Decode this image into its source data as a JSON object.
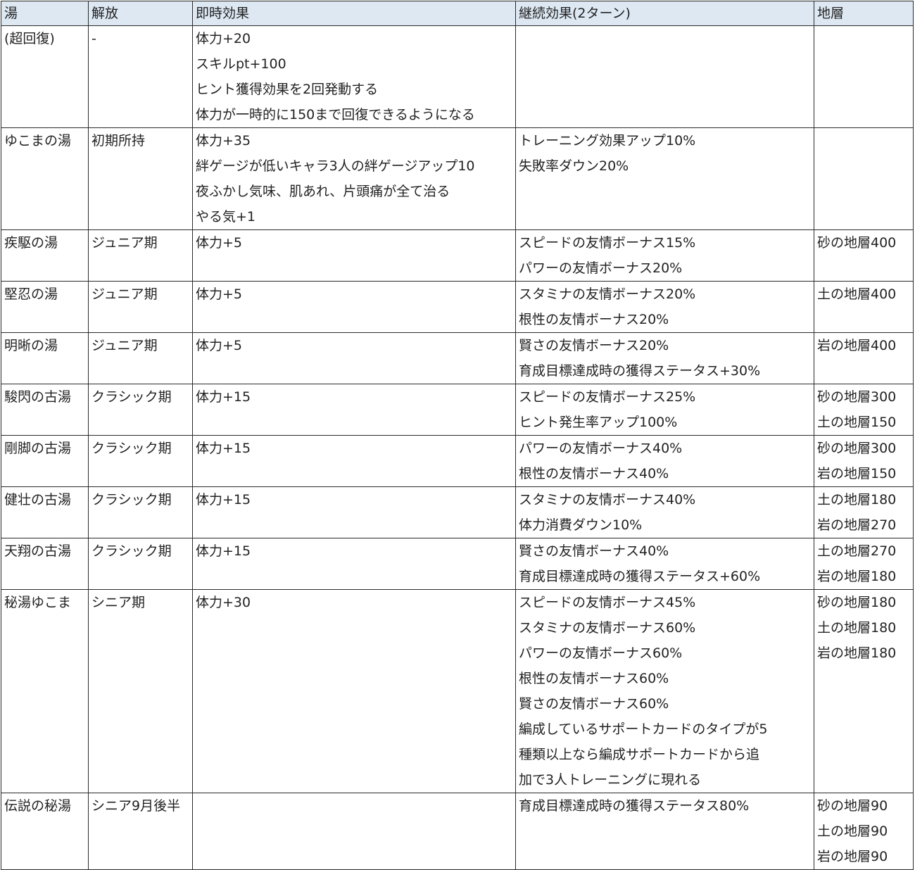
{
  "headers": [
    "湯",
    "解放",
    "即時効果",
    "継続効果(2ターン)",
    "地層"
  ],
  "rows": [
    {
      "name": "(超回復)",
      "unlock": "-",
      "immediate": [
        "体力+20",
        "スキルpt+100",
        "ヒント獲得効果を2回発動する",
        "体力が一時的に150まで回復できるようになる"
      ],
      "continuous": [],
      "strata": []
    },
    {
      "name": "ゆこまの湯",
      "unlock": "初期所持",
      "immediate": [
        "体力+35",
        "絆ゲージが低いキャラ3人の絆ゲージアップ10",
        "夜ふかし気味、肌あれ、片頭痛が全て治る",
        "やる気+1"
      ],
      "continuous": [
        "トレーニング効果アップ10%",
        "失敗率ダウン20%"
      ],
      "strata": []
    },
    {
      "name": "疾駆の湯",
      "unlock": "ジュニア期",
      "immediate": [
        "体力+5"
      ],
      "continuous": [
        "スピードの友情ボーナス15%",
        "パワーの友情ボーナス20%"
      ],
      "strata": [
        "砂の地層400"
      ]
    },
    {
      "name": "堅忍の湯",
      "unlock": "ジュニア期",
      "immediate": [
        "体力+5"
      ],
      "continuous": [
        "スタミナの友情ボーナス20%",
        "根性の友情ボーナス20%"
      ],
      "strata": [
        "土の地層400"
      ]
    },
    {
      "name": "明晰の湯",
      "unlock": "ジュニア期",
      "immediate": [
        "体力+5"
      ],
      "continuous": [
        "賢さの友情ボーナス20%",
        "育成目標達成時の獲得ステータス+30%"
      ],
      "strata": [
        "岩の地層400"
      ]
    },
    {
      "name": "駿閃の古湯",
      "unlock": "クラシック期",
      "immediate": [
        "体力+15"
      ],
      "continuous": [
        "スピードの友情ボーナス25%",
        "ヒント発生率アップ100%"
      ],
      "strata": [
        "砂の地層300",
        "土の地層150"
      ]
    },
    {
      "name": "剛脚の古湯",
      "unlock": "クラシック期",
      "immediate": [
        "体力+15"
      ],
      "continuous": [
        "パワーの友情ボーナス40%",
        "根性の友情ボーナス40%"
      ],
      "strata": [
        "砂の地層300",
        "岩の地層150"
      ]
    },
    {
      "name": "健壮の古湯",
      "unlock": "クラシック期",
      "immediate": [
        "体力+15"
      ],
      "continuous": [
        "スタミナの友情ボーナス40%",
        "体力消費ダウン10%"
      ],
      "strata": [
        "土の地層180",
        "岩の地層270"
      ]
    },
    {
      "name": "天翔の古湯",
      "unlock": "クラシック期",
      "immediate": [
        "体力+15"
      ],
      "continuous": [
        "賢さの友情ボーナス40%",
        "育成目標達成時の獲得ステータス+60%"
      ],
      "strata": [
        "土の地層270",
        "岩の地層180"
      ]
    },
    {
      "name": "秘湯ゆこま",
      "unlock": "シニア期",
      "immediate": [
        "体力+30"
      ],
      "continuous": [
        "スピードの友情ボーナス45%",
        "スタミナの友情ボーナス60%",
        "パワーの友情ボーナス60%",
        "根性の友情ボーナス60%",
        "賢さの友情ボーナス60%",
        "編成しているサポートカードのタイプが5",
        "種類以上なら編成サポートカードから追",
        "加で3人トレーニングに現れる"
      ],
      "strata": [
        "砂の地層180",
        "土の地層180",
        "岩の地層180"
      ]
    },
    {
      "name": "伝説の秘湯",
      "unlock": "シニア9月後半",
      "immediate": [],
      "continuous": [
        "育成目標達成時の獲得ステータス80%"
      ],
      "strata": [
        "砂の地層90",
        "土の地層90",
        "岩の地層90"
      ]
    }
  ],
  "colors": {
    "header_bg": "#dde8f3",
    "border": "#2a2a2a",
    "text": "#222222"
  }
}
